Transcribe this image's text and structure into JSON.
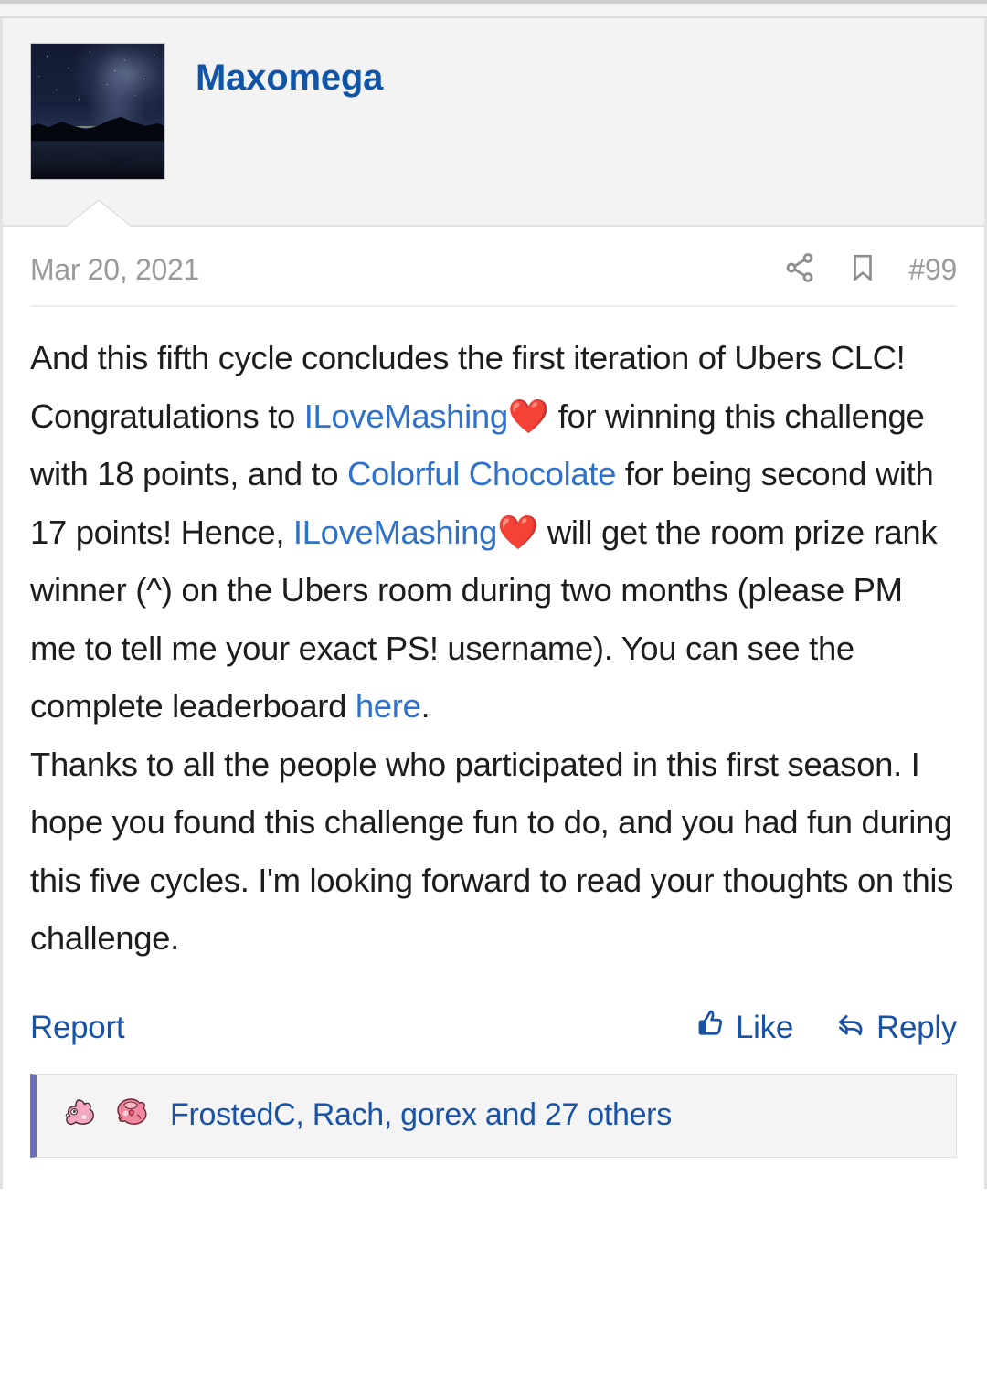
{
  "post": {
    "author": "Maxomega",
    "avatar_alt": "night-sky-landscape-avatar",
    "date": "Mar 20, 2021",
    "post_number": "#99",
    "icons": {
      "share": "share-icon",
      "bookmark": "bookmark-icon"
    },
    "body": {
      "paragraph1": {
        "seg1": "And this fifth cycle concludes the first iteration of Ubers CLC! Congratulations to ",
        "link1": "ILoveMashing",
        "heart1": "❤️",
        "seg2": " for winning this challenge with 18 points, and to ",
        "link2": "Colorful Chocolate",
        "seg3": " for being second with 17 points! Hence, ",
        "link3": "ILoveMashing",
        "heart2": "❤️",
        "seg4": " will get the room prize rank winner (^) on the Ubers room during two months (please PM me to tell me your exact PS! username). You can see the complete leaderboard ",
        "link4": "here",
        "seg5": "."
      },
      "paragraph2": "Thanks to all the people who participated in this first season. I hope you found this challenge fun to do, and you had fun during this five cycles. I'm looking forward to read your thoughts on this challenge."
    },
    "actions": {
      "report": "Report",
      "like": "Like",
      "reply": "Reply"
    },
    "likes": {
      "text": "FrostedC, Rach, gorex and 27 others",
      "reactor_icons": [
        "pink-pokemon-sprite",
        "pink-pokemon-sprite-2"
      ]
    }
  },
  "colors": {
    "link_blue": "#2f70c9",
    "action_blue": "#1a53a5",
    "username_blue": "#1155a8",
    "meta_gray": "#9a9a9a",
    "heart_red": "#e8242a",
    "likes_accent": "#6d6dba"
  }
}
